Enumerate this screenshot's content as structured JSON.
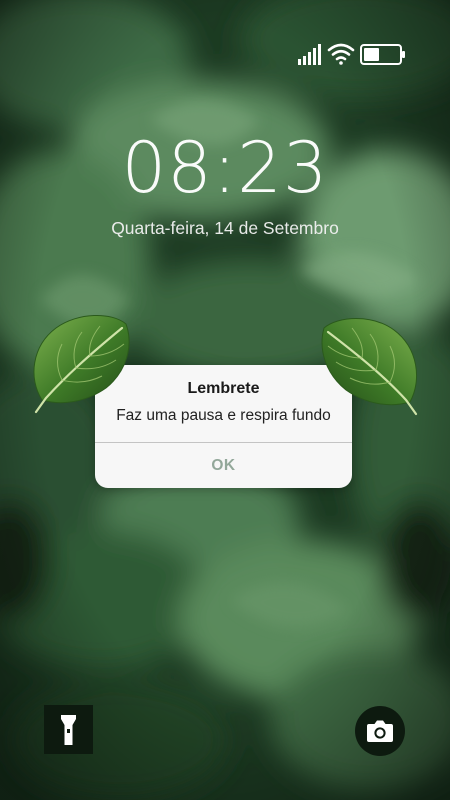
{
  "lock_screen": {
    "time": "08:23",
    "date": "Quarta-feira, 14 de Setembro"
  },
  "status_bar": {
    "icons": [
      "signal-icon",
      "wifi-icon",
      "battery-icon"
    ],
    "battery_level_fraction": 0.45
  },
  "alert": {
    "title": "Lembrete",
    "message": "Faz uma pausa e respira fundo",
    "ok_label": "OK",
    "ok_color": "#93a89a"
  },
  "quick_actions": {
    "left_icon": "flashlight-icon",
    "right_icon": "camera-icon"
  },
  "colors": {
    "background_dark": "#0d1a0f",
    "leaf_green": "#3f7a2a",
    "dialog_bg": "#f7f7f7"
  }
}
